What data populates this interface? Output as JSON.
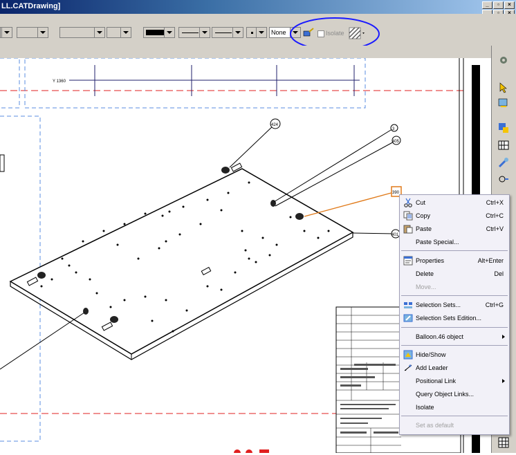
{
  "window": {
    "title": "LL.CATDrawing]"
  },
  "toolbar": {
    "linetype_none": "None",
    "isolate_label": "Isolate"
  },
  "drawing": {
    "dim_label": "Y 1360",
    "balloons": [
      "424",
      "3",
      "405",
      "390",
      "401"
    ],
    "annotation_color": "#1a1aff",
    "highlight_color": "#e07a1a"
  },
  "context_menu": {
    "items": [
      {
        "label": "Cut",
        "shortcut": "Ctrl+X",
        "icon": "scissors-icon",
        "enabled": true
      },
      {
        "label": "Copy",
        "shortcut": "Ctrl+C",
        "icon": "copy-icon",
        "enabled": true
      },
      {
        "label": "Paste",
        "shortcut": "Ctrl+V",
        "icon": "paste-icon",
        "enabled": true
      },
      {
        "label": "Paste Special...",
        "shortcut": "",
        "icon": "",
        "enabled": true
      },
      {
        "label": "Properties",
        "shortcut": "Alt+Enter",
        "icon": "properties-icon",
        "enabled": true
      },
      {
        "label": "Delete",
        "shortcut": "Del",
        "icon": "",
        "enabled": true
      },
      {
        "label": "Move...",
        "shortcut": "",
        "icon": "",
        "enabled": false
      },
      {
        "label": "Selection Sets...",
        "shortcut": "Ctrl+G",
        "icon": "selection-sets-icon",
        "enabled": true
      },
      {
        "label": "Selection Sets Edition...",
        "shortcut": "",
        "icon": "selection-sets-edition-icon",
        "enabled": true
      },
      {
        "label": "Balloon.46 object",
        "shortcut": "",
        "icon": "",
        "enabled": true,
        "submenu": true
      },
      {
        "label": "Hide/Show",
        "shortcut": "",
        "icon": "hide-show-icon",
        "enabled": true
      },
      {
        "label": "Add Leader",
        "shortcut": "",
        "icon": "add-leader-icon",
        "enabled": true
      },
      {
        "label": "Positional Link",
        "shortcut": "",
        "icon": "",
        "enabled": true,
        "submenu": true
      },
      {
        "label": "Query Object Links...",
        "shortcut": "",
        "icon": "",
        "enabled": true
      },
      {
        "label": "Isolate",
        "shortcut": "",
        "icon": "",
        "enabled": true
      },
      {
        "label": "Set as default",
        "shortcut": "",
        "icon": "",
        "enabled": false
      }
    ]
  }
}
